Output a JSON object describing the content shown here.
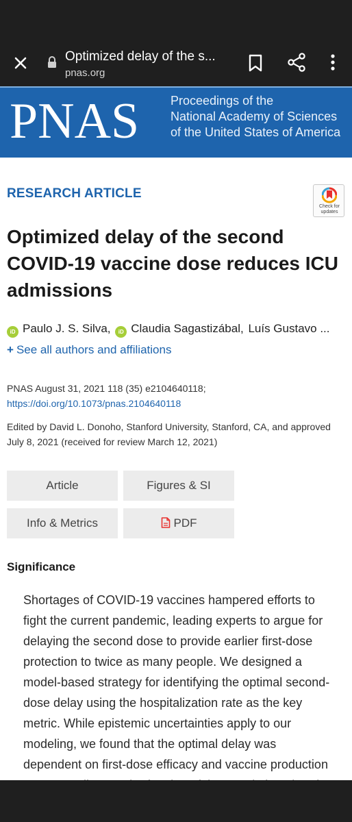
{
  "browser": {
    "tab_title": "Optimized delay of the s...",
    "domain": "pnas.org",
    "icons": [
      "close-icon",
      "lock-icon",
      "bookmark-icon",
      "share-icon",
      "more-vert-icon"
    ]
  },
  "banner": {
    "logo": "PNAS",
    "subtitle_lines": [
      "Proceedings of the",
      "National Academy of Sciences",
      "of the United States of America"
    ],
    "color": "#1e64ad"
  },
  "article": {
    "type": "RESEARCH ARTICLE",
    "check_updates": [
      "Check for",
      "updates"
    ],
    "title": "Optimized delay of the second COVID-19 vaccine dose reduces ICU admissions",
    "authors": [
      "Paulo J. S. Silva,",
      "Claudia Sagastizábal,",
      "Luís Gustavo ..."
    ],
    "see_all": "See all authors and affiliations",
    "citation": "PNAS August 31, 2021 118 (35) e2104640118;",
    "doi": "https://doi.org/10.1073/pnas.2104640118",
    "edited": "Edited by David L. Donoho, Stanford University, Stanford, CA, and approved July 8, 2021 (received for review March 12, 2021)"
  },
  "tabs": {
    "article": "Article",
    "figures": "Figures & SI",
    "info": "Info & Metrics",
    "pdf": "PDF"
  },
  "significance": {
    "heading": "Significance",
    "body": "Shortages of COVID-19 vaccines hampered efforts to fight the current pandemic, leading experts to argue for delaying the second dose to provide earlier first-dose protection to twice as many people. We designed a model-based strategy for identifying the optimal second-dose delay using the hospitalization rate as the key metric. While epistemic uncertainties apply to our modeling, we found that the optimal delay was dependent on first-dose efficacy and vaccine production rate, as well as on the fraction of the population already immunized."
  },
  "colors": {
    "link": "#1e64ad",
    "orcid": "#a6ce39",
    "pdf_icon": "#e8312f",
    "chrome": "#1f1f1f"
  }
}
